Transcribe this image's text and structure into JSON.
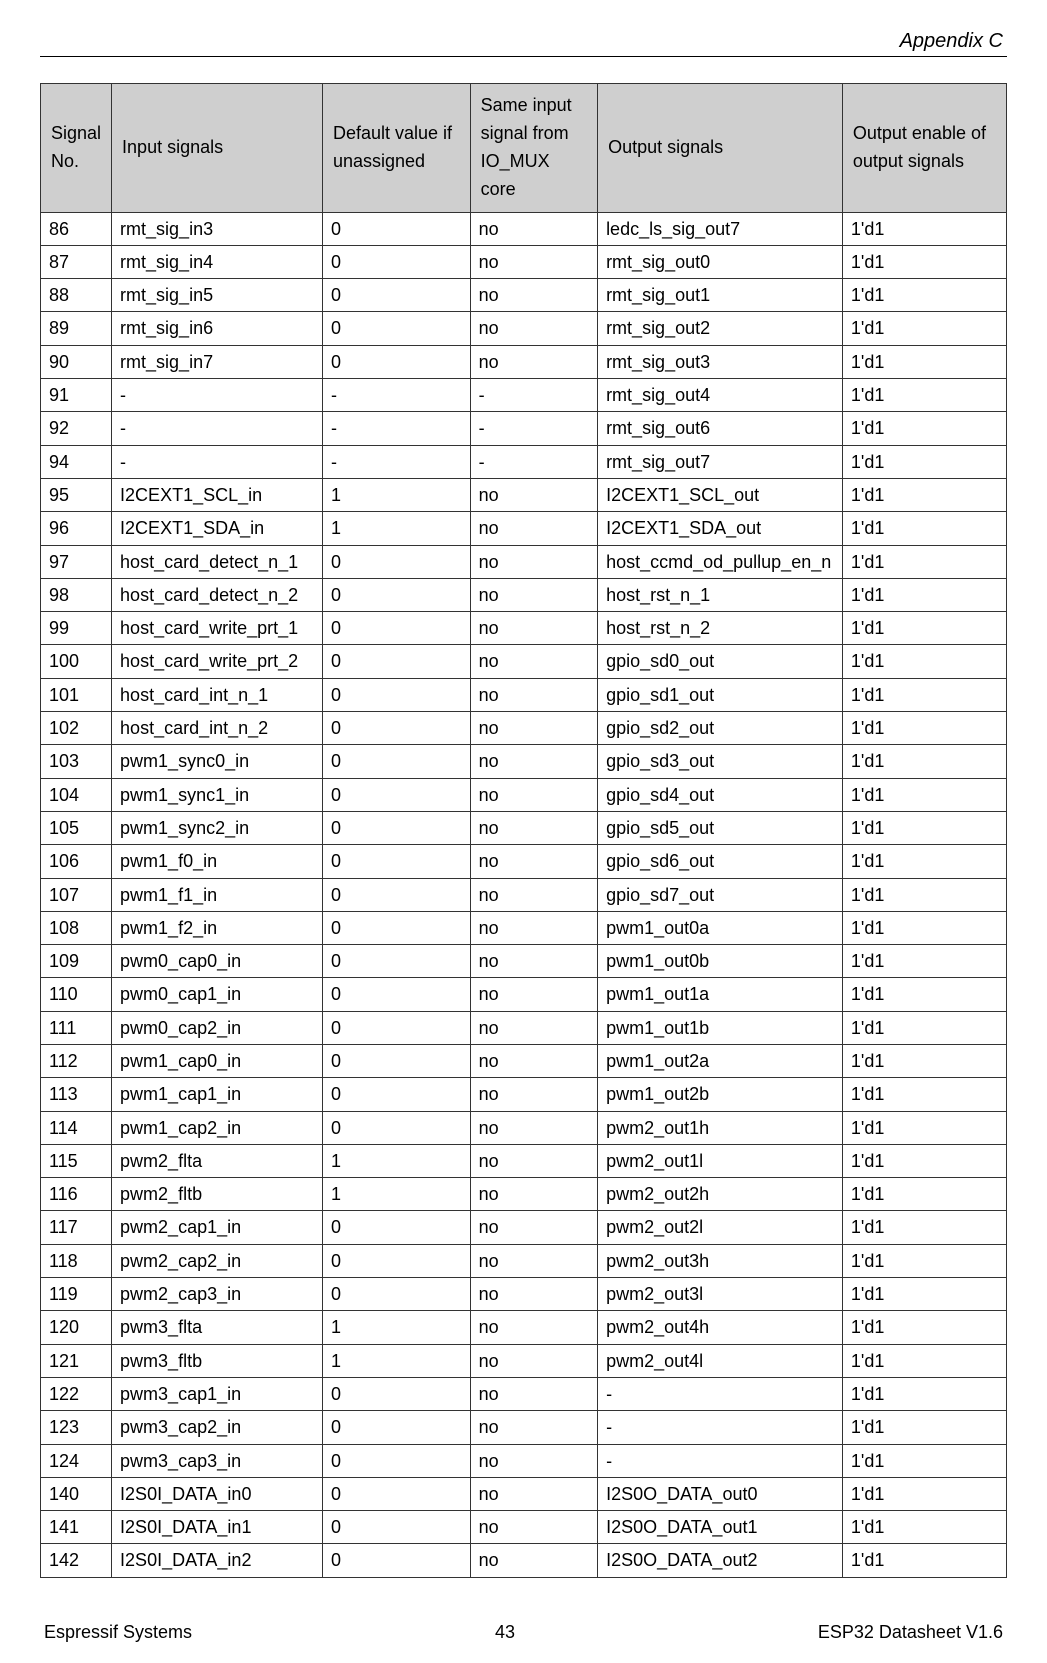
{
  "header": {
    "section_title": "Appendix C"
  },
  "table": {
    "columns": [
      "Signal No.",
      "Input signals",
      "Default value if unassigned",
      "Same input signal from IO_MUX core",
      "Output signals",
      "Output enable of output signals"
    ],
    "rows": [
      {
        "no": "86",
        "in": "rmt_sig_in3",
        "def": "0",
        "mux": "no",
        "out": "ledc_ls_sig_out7",
        "oe": "1'd1"
      },
      {
        "no": "87",
        "in": "rmt_sig_in4",
        "def": "0",
        "mux": "no",
        "out": "rmt_sig_out0",
        "oe": "1'd1"
      },
      {
        "no": "88",
        "in": "rmt_sig_in5",
        "def": "0",
        "mux": "no",
        "out": "rmt_sig_out1",
        "oe": "1'd1"
      },
      {
        "no": "89",
        "in": "rmt_sig_in6",
        "def": "0",
        "mux": "no",
        "out": "rmt_sig_out2",
        "oe": "1'd1"
      },
      {
        "no": "90",
        "in": "rmt_sig_in7",
        "def": "0",
        "mux": "no",
        "out": "rmt_sig_out3",
        "oe": "1'd1"
      },
      {
        "no": "91",
        "in": "-",
        "def": "-",
        "mux": "-",
        "out": "rmt_sig_out4",
        "oe": "1'd1"
      },
      {
        "no": "92",
        "in": "-",
        "def": "-",
        "mux": "-",
        "out": "rmt_sig_out6",
        "oe": "1'd1"
      },
      {
        "no": "94",
        "in": "-",
        "def": "-",
        "mux": "-",
        "out": "rmt_sig_out7",
        "oe": "1'd1"
      },
      {
        "no": "95",
        "in": "I2CEXT1_SCL_in",
        "def": "1",
        "mux": "no",
        "out": "I2CEXT1_SCL_out",
        "oe": "1'd1"
      },
      {
        "no": "96",
        "in": "I2CEXT1_SDA_in",
        "def": "1",
        "mux": "no",
        "out": "I2CEXT1_SDA_out",
        "oe": "1'd1"
      },
      {
        "no": "97",
        "in": "host_card_detect_n_1",
        "def": "0",
        "mux": "no",
        "out": "host_ccmd_od_pullup_en_n",
        "oe": "1'd1"
      },
      {
        "no": "98",
        "in": "host_card_detect_n_2",
        "def": "0",
        "mux": "no",
        "out": "host_rst_n_1",
        "oe": "1'd1"
      },
      {
        "no": "99",
        "in": "host_card_write_prt_1",
        "def": "0",
        "mux": "no",
        "out": "host_rst_n_2",
        "oe": "1'd1"
      },
      {
        "no": "100",
        "in": "host_card_write_prt_2",
        "def": "0",
        "mux": "no",
        "out": "gpio_sd0_out",
        "oe": "1'd1"
      },
      {
        "no": "101",
        "in": "host_card_int_n_1",
        "def": "0",
        "mux": "no",
        "out": "gpio_sd1_out",
        "oe": "1'd1"
      },
      {
        "no": "102",
        "in": "host_card_int_n_2",
        "def": "0",
        "mux": "no",
        "out": "gpio_sd2_out",
        "oe": "1'd1"
      },
      {
        "no": "103",
        "in": "pwm1_sync0_in",
        "def": "0",
        "mux": "no",
        "out": "gpio_sd3_out",
        "oe": "1'd1"
      },
      {
        "no": "104",
        "in": "pwm1_sync1_in",
        "def": "0",
        "mux": "no",
        "out": "gpio_sd4_out",
        "oe": "1'd1"
      },
      {
        "no": "105",
        "in": "pwm1_sync2_in",
        "def": "0",
        "mux": "no",
        "out": "gpio_sd5_out",
        "oe": "1'd1"
      },
      {
        "no": "106",
        "in": "pwm1_f0_in",
        "def": "0",
        "mux": "no",
        "out": "gpio_sd6_out",
        "oe": "1'd1"
      },
      {
        "no": "107",
        "in": "pwm1_f1_in",
        "def": "0",
        "mux": "no",
        "out": "gpio_sd7_out",
        "oe": "1'd1"
      },
      {
        "no": "108",
        "in": "pwm1_f2_in",
        "def": "0",
        "mux": "no",
        "out": "pwm1_out0a",
        "oe": "1'd1"
      },
      {
        "no": "109",
        "in": "pwm0_cap0_in",
        "def": "0",
        "mux": "no",
        "out": "pwm1_out0b",
        "oe": "1'd1"
      },
      {
        "no": "110",
        "in": "pwm0_cap1_in",
        "def": "0",
        "mux": "no",
        "out": "pwm1_out1a",
        "oe": "1'd1"
      },
      {
        "no": "111",
        "in": "pwm0_cap2_in",
        "def": "0",
        "mux": "no",
        "out": "pwm1_out1b",
        "oe": "1'd1"
      },
      {
        "no": "112",
        "in": "pwm1_cap0_in",
        "def": "0",
        "mux": "no",
        "out": "pwm1_out2a",
        "oe": "1'd1"
      },
      {
        "no": "113",
        "in": "pwm1_cap1_in",
        "def": "0",
        "mux": "no",
        "out": "pwm1_out2b",
        "oe": "1'd1"
      },
      {
        "no": "114",
        "in": "pwm1_cap2_in",
        "def": "0",
        "mux": "no",
        "out": "pwm2_out1h",
        "oe": "1'd1"
      },
      {
        "no": "115",
        "in": "pwm2_flta",
        "def": "1",
        "mux": "no",
        "out": "pwm2_out1l",
        "oe": "1'd1"
      },
      {
        "no": "116",
        "in": "pwm2_fltb",
        "def": "1",
        "mux": "no",
        "out": "pwm2_out2h",
        "oe": "1'd1"
      },
      {
        "no": "117",
        "in": "pwm2_cap1_in",
        "def": "0",
        "mux": "no",
        "out": "pwm2_out2l",
        "oe": "1'd1"
      },
      {
        "no": "118",
        "in": "pwm2_cap2_in",
        "def": "0",
        "mux": "no",
        "out": "pwm2_out3h",
        "oe": "1'd1"
      },
      {
        "no": "119",
        "in": "pwm2_cap3_in",
        "def": "0",
        "mux": "no",
        "out": "pwm2_out3l",
        "oe": "1'd1"
      },
      {
        "no": "120",
        "in": "pwm3_flta",
        "def": "1",
        "mux": "no",
        "out": "pwm2_out4h",
        "oe": "1'd1"
      },
      {
        "no": "121",
        "in": "pwm3_fltb",
        "def": "1",
        "mux": "no",
        "out": "pwm2_out4l",
        "oe": "1'd1"
      },
      {
        "no": "122",
        "in": "pwm3_cap1_in",
        "def": "0",
        "mux": "no",
        "out": "-",
        "oe": "1'd1"
      },
      {
        "no": "123",
        "in": "pwm3_cap2_in",
        "def": "0",
        "mux": "no",
        "out": "-",
        "oe": "1'd1"
      },
      {
        "no": "124",
        "in": "pwm3_cap3_in",
        "def": "0",
        "mux": "no",
        "out": "-",
        "oe": "1'd1"
      },
      {
        "no": "140",
        "in": "I2S0I_DATA_in0",
        "def": "0",
        "mux": "no",
        "out": "I2S0O_DATA_out0",
        "oe": "1'd1"
      },
      {
        "no": "141",
        "in": "I2S0I_DATA_in1",
        "def": "0",
        "mux": "no",
        "out": "I2S0O_DATA_out1",
        "oe": "1'd1"
      },
      {
        "no": "142",
        "in": "I2S0I_DATA_in2",
        "def": "0",
        "mux": "no",
        "out": "I2S0O_DATA_out2",
        "oe": "1'd1"
      }
    ]
  },
  "footer": {
    "left": "Espressif Systems",
    "center": "43",
    "right": "ESP32 Datasheet V1.6"
  }
}
